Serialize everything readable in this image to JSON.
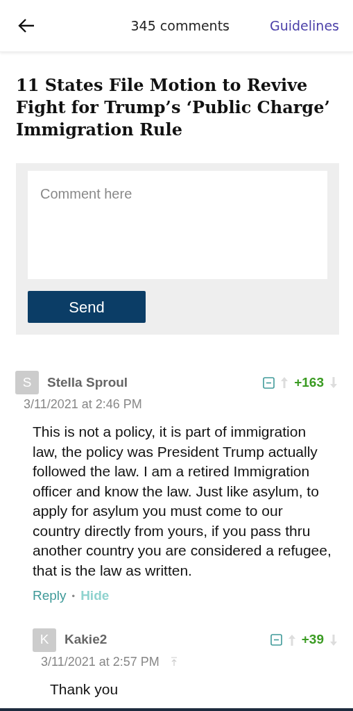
{
  "header": {
    "comment_count": "345 comments",
    "guidelines_link": "Guidelines"
  },
  "article_title": "11 States File Motion to Revive Fight for Trump’s ‘Public Charge’ Immigration Rule",
  "comment_form": {
    "placeholder": "Comment here",
    "send_button": "Send"
  },
  "comments": [
    {
      "initial": "S",
      "author": "Stella Sproul",
      "date": "3/11/2021 at 2:46 PM",
      "score": "+163",
      "body": "This is not a policy, it is part of immigration law, the policy was President Trump actually followed the law. I am a retired Immigration officer and know the law. Just like asylum, to apply for asylum you must come to our country directly from yours, if you pass thru another country you are considered a refugee, that is the law as written.",
      "actions": [
        "Reply",
        "Hide"
      ],
      "action_separator": "•",
      "children": [
        {
          "initial": "K",
          "author": "Kakie2",
          "date": "3/11/2021 at 2:57 PM",
          "score": "+39",
          "body": "Thank you",
          "jump_to_parent": true
        }
      ]
    }
  ]
}
